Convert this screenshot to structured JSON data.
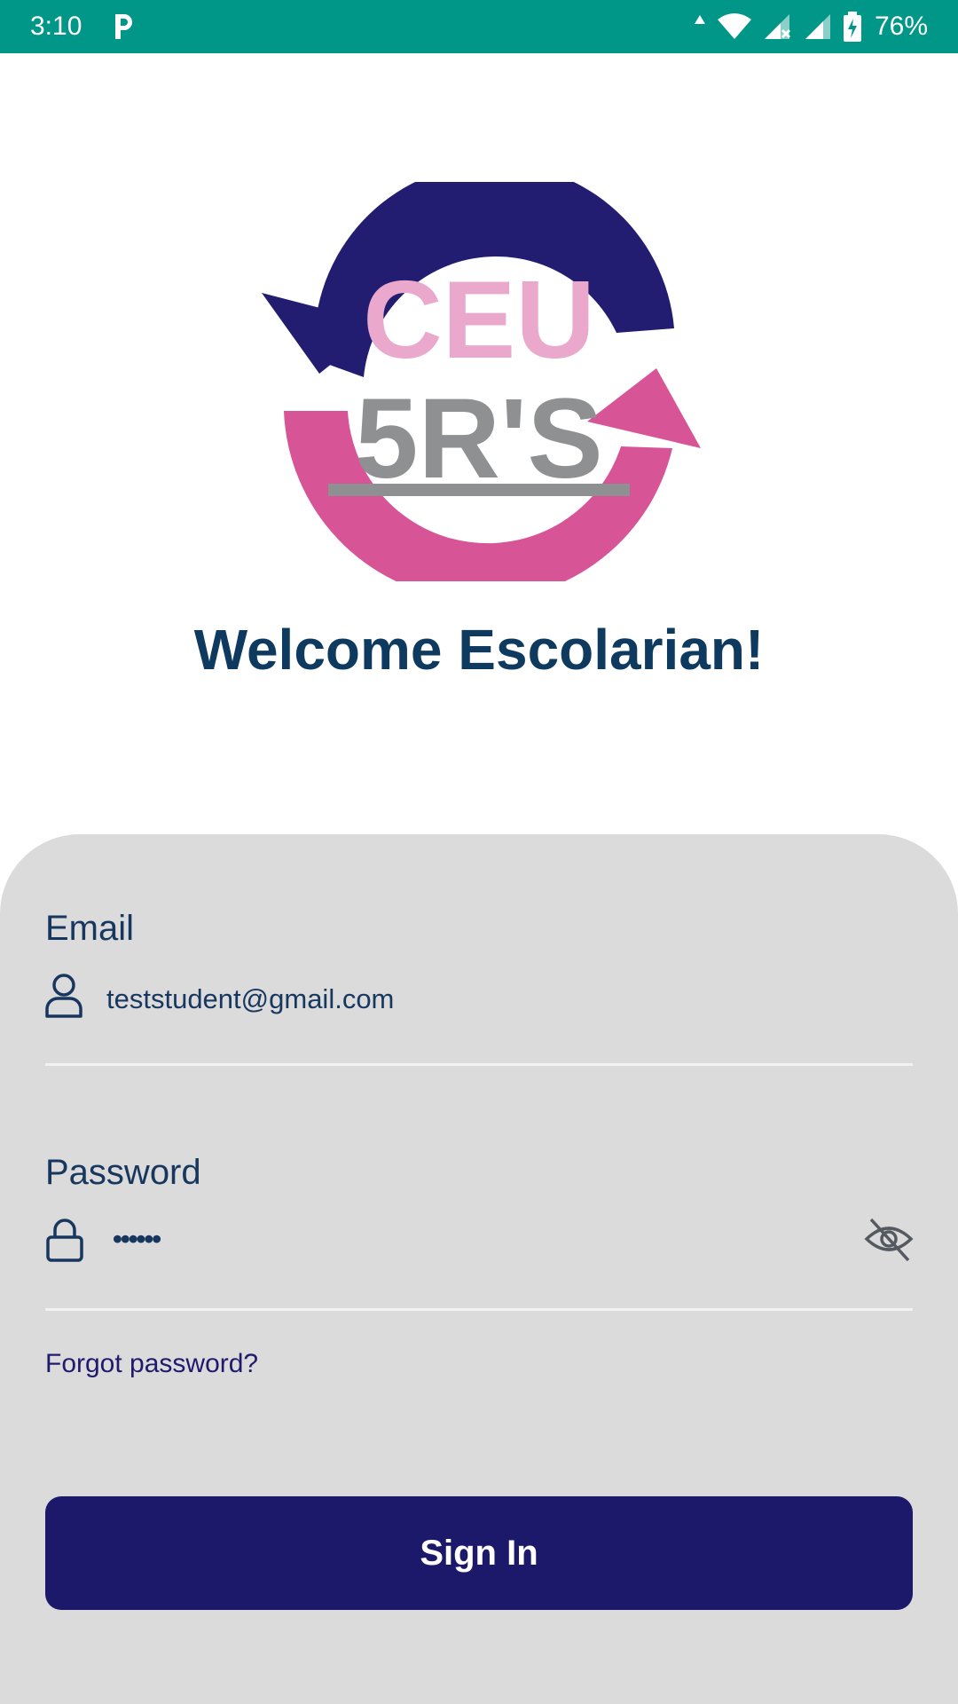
{
  "status_bar": {
    "time": "3:10",
    "battery_percent": "76%",
    "background": "#009688",
    "icons": [
      "parking-app-icon",
      "data-arrows-icon",
      "wifi-icon",
      "signal-no-data-icon",
      "signal-icon",
      "battery-charging-icon"
    ]
  },
  "logo": {
    "text_top": "CEU",
    "text_bottom": "5R'S",
    "colors": {
      "navy": "#231d72",
      "pink": "#d75496",
      "light_pink": "#eaa8cc",
      "gray": "#8f9092"
    }
  },
  "welcome": {
    "title": "Welcome Escolarian!"
  },
  "form": {
    "email": {
      "label": "Email",
      "value": "teststudent@gmail.com",
      "icon": "person-icon"
    },
    "password": {
      "label": "Password",
      "value": "••••••",
      "icon": "lock-icon",
      "toggle_icon": "eye-off-icon"
    },
    "forgot_password": "Forgot password?",
    "sign_in": "Sign In"
  },
  "colors": {
    "title": "#0e3a5f",
    "card_background": "#dbdbdc",
    "button": "#1c196b",
    "link": "#1f1a6b"
  }
}
